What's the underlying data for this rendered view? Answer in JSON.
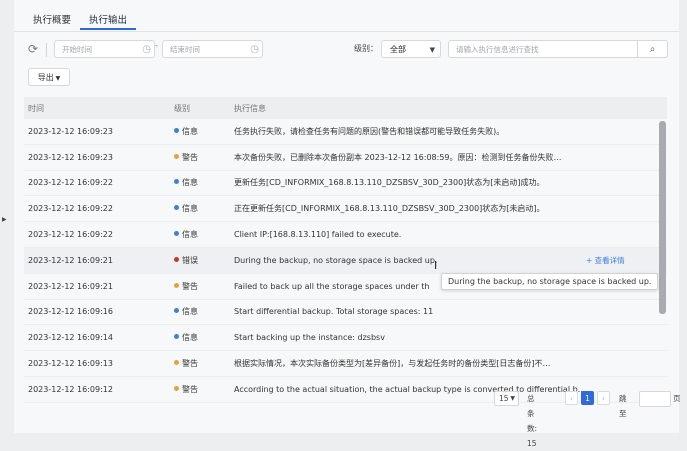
{
  "tabs": [
    "执行概要",
    "执行输出"
  ],
  "toolbar": {
    "start_placeholder": "开始时间",
    "end_placeholder": "结束时间",
    "date_separator": "-",
    "level_label": "级别：",
    "level_value": "全部",
    "search_placeholder": "请输入执行信息进行查找",
    "export_label": "导出"
  },
  "table": {
    "headers": [
      "时间",
      "级别",
      "执行信息"
    ],
    "rows": [
      {
        "time": "2023-12-12 16:09:23",
        "level": "信息",
        "level_color": "#3b82d6",
        "message": "任务执行失败，请检查任务有问题的原因(警告和错误都可能导致任务失败)。"
      },
      {
        "time": "2023-12-12 16:09:23",
        "level": "警告",
        "level_color": "#e6a23c",
        "message": "本次备份失败，已删除本次备份副本 2023-12-12 16:08:59。原因：检测到任务备份失败…"
      },
      {
        "time": "2023-12-12 16:09:22",
        "level": "信息",
        "level_color": "#3b82d6",
        "message": "更新任务[CD_INFORMIX_168.8.13.110_DZSBSV_30D_2300]状态为[未启动]成功。"
      },
      {
        "time": "2023-12-12 16:09:22",
        "level": "信息",
        "level_color": "#3b82d6",
        "message": "正在更新任务[CD_INFORMIX_168.8.13.110_DZSBSV_30D_2300]状态为[未启动]。"
      },
      {
        "time": "2023-12-12 16:09:22",
        "level": "信息",
        "level_color": "#3b82d6",
        "message": "Client IP:[168.8.13.110] failed to execute."
      },
      {
        "time": "2023-12-12 16:09:21",
        "level": "错误",
        "level_color": "#c0392b",
        "message": "During the backup, no storage space is backed up."
      },
      {
        "time": "2023-12-12 16:09:21",
        "level": "警告",
        "level_color": "#e6a23c",
        "message": "Failed to back up all the storage spaces under th"
      },
      {
        "time": "2023-12-12 16:09:16",
        "level": "信息",
        "level_color": "#3b82d6",
        "message": "Start differential backup. Total storage spaces: 11"
      },
      {
        "time": "2023-12-12 16:09:14",
        "level": "信息",
        "level_color": "#3b82d6",
        "message": "Start backing up the instance: dzsbsv"
      },
      {
        "time": "2023-12-12 16:09:13",
        "level": "警告",
        "level_color": "#e6a23c",
        "message": "根据实际情况，本次实际备份类型为[差异备份]，与发起任务时的备份类型[日志备份]不…"
      },
      {
        "time": "2023-12-12 16:09:12",
        "level": "警告",
        "level_color": "#e6a23c",
        "message": "According to the actual situation, the actual backup type is converted to differential b…"
      }
    ],
    "detail_link": "+ 查看详情",
    "tooltip": "During the backup, no storage space is backed up."
  },
  "pagination": {
    "page_size": "15",
    "total_label": "总条数: 15",
    "current_page": "1",
    "jump_label": "跳至",
    "page_suffix": "页"
  }
}
